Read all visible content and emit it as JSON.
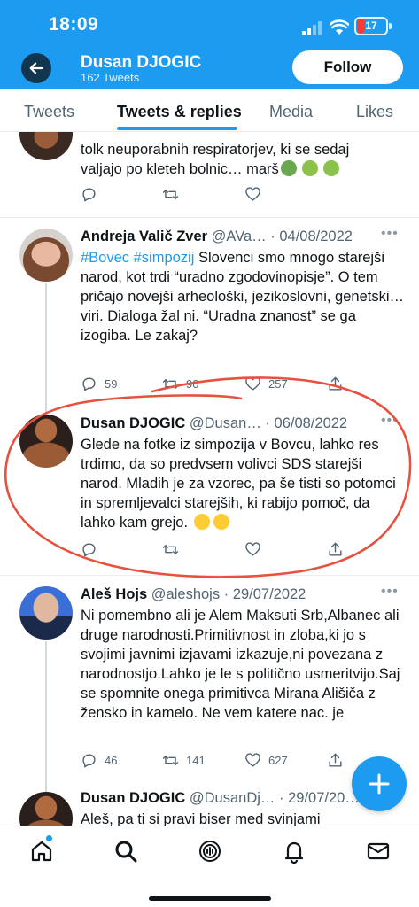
{
  "status_bar": {
    "time": "18:09",
    "battery_level": "17"
  },
  "header": {
    "name": "Dusan DJOGIC",
    "tweet_count": "162 Tweets",
    "follow_label": "Follow",
    "background_color": "#1d9bf0"
  },
  "tabs": [
    {
      "label": "Tweets",
      "active": false
    },
    {
      "label": "Tweets & replies",
      "active": true
    },
    {
      "label": "Media",
      "active": false
    },
    {
      "label": "Likes",
      "active": false
    }
  ],
  "tweets": [
    {
      "partial": true,
      "text_line1": "tolk neuporabnih respiratorjev, ki se sedaj",
      "text_line2": "valjajo po kleteh bolnic… marš",
      "emojis": [
        "nauseated-face",
        "vomiting-face",
        "vomiting-face"
      ]
    },
    {
      "name": "Andreja Valič Zver",
      "handle": "@AVa…",
      "date": "04/08/2022",
      "hashtags": "#Bovec #simpozij",
      "text_after_tags": " Slovenci smo mnogo",
      "text_rest": "starejši narod, kot trdi “uradno zgodovinopisje”. O tem pričajo novejši arheološki, jezikoslovni, genetski… viri. Dialoga žal ni. “Uradna znanost” se ga izogiba. Le zakaj?",
      "replies": "59",
      "retweets": "90",
      "likes": "257"
    },
    {
      "name": "Dusan DJOGIC",
      "handle": "@Dusan…",
      "date": "06/08/2022",
      "text": "Glede na fotke iz simpozija v Bovcu,  lahko res trdimo, da so predvsem volivci SDS starejši narod. Mladih je za vzorec, pa še tisti so potomci in spremljevalci starejših, ki rabijo pomoč, da lahko kam grejo.",
      "emojis": [
        "zany-face",
        "tears-of-joy"
      ]
    },
    {
      "name": "Aleš Hojs",
      "handle": "@aleshojs",
      "date": "29/07/2022",
      "text": "Ni pomembno ali je Alem Maksuti Srb,Albanec ali druge narodnosti.Primitivnost in zloba,ki jo s svojimi javnimi izjavami izkazuje,ni povezana z narodnostjo.Lahko je le s politično usmeritvijo.Saj se spomnite onega primitivca Mirana Ališiča z žensko in kamelo. Ne vem katere nac. je",
      "replies": "46",
      "retweets": "141",
      "likes": "627"
    },
    {
      "partial": true,
      "name": "Dusan DJOGIC",
      "handle": "@DusanDj…",
      "date": "29/07/20…",
      "text": "Aleš, pa ti si pravi biser med svinjami"
    }
  ],
  "annotation": {
    "color": "#e8503f"
  },
  "bottom_nav": [
    "home-icon",
    "search-icon",
    "spaces-icon",
    "notifications-icon",
    "messages-icon"
  ]
}
